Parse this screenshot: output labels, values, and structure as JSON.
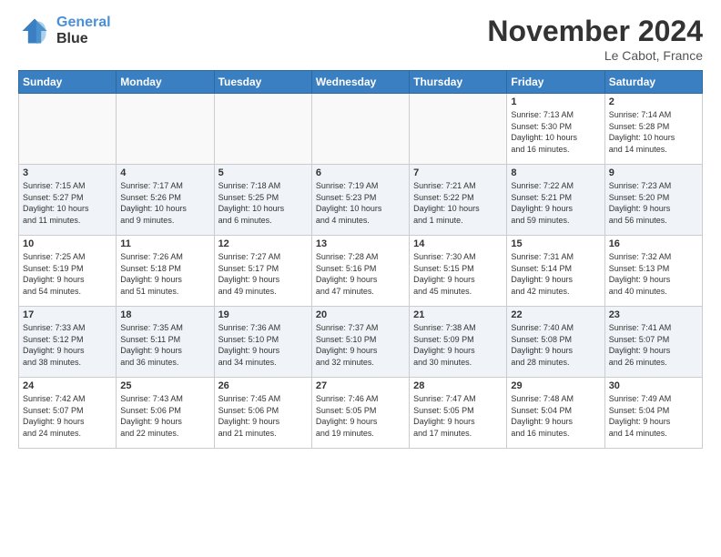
{
  "header": {
    "logo_line1": "General",
    "logo_line2": "Blue",
    "month_title": "November 2024",
    "location": "Le Cabot, France"
  },
  "weekdays": [
    "Sunday",
    "Monday",
    "Tuesday",
    "Wednesday",
    "Thursday",
    "Friday",
    "Saturday"
  ],
  "weeks": [
    [
      {
        "day": "",
        "info": ""
      },
      {
        "day": "",
        "info": ""
      },
      {
        "day": "",
        "info": ""
      },
      {
        "day": "",
        "info": ""
      },
      {
        "day": "",
        "info": ""
      },
      {
        "day": "1",
        "info": "Sunrise: 7:13 AM\nSunset: 5:30 PM\nDaylight: 10 hours\nand 16 minutes."
      },
      {
        "day": "2",
        "info": "Sunrise: 7:14 AM\nSunset: 5:28 PM\nDaylight: 10 hours\nand 14 minutes."
      }
    ],
    [
      {
        "day": "3",
        "info": "Sunrise: 7:15 AM\nSunset: 5:27 PM\nDaylight: 10 hours\nand 11 minutes."
      },
      {
        "day": "4",
        "info": "Sunrise: 7:17 AM\nSunset: 5:26 PM\nDaylight: 10 hours\nand 9 minutes."
      },
      {
        "day": "5",
        "info": "Sunrise: 7:18 AM\nSunset: 5:25 PM\nDaylight: 10 hours\nand 6 minutes."
      },
      {
        "day": "6",
        "info": "Sunrise: 7:19 AM\nSunset: 5:23 PM\nDaylight: 10 hours\nand 4 minutes."
      },
      {
        "day": "7",
        "info": "Sunrise: 7:21 AM\nSunset: 5:22 PM\nDaylight: 10 hours\nand 1 minute."
      },
      {
        "day": "8",
        "info": "Sunrise: 7:22 AM\nSunset: 5:21 PM\nDaylight: 9 hours\nand 59 minutes."
      },
      {
        "day": "9",
        "info": "Sunrise: 7:23 AM\nSunset: 5:20 PM\nDaylight: 9 hours\nand 56 minutes."
      }
    ],
    [
      {
        "day": "10",
        "info": "Sunrise: 7:25 AM\nSunset: 5:19 PM\nDaylight: 9 hours\nand 54 minutes."
      },
      {
        "day": "11",
        "info": "Sunrise: 7:26 AM\nSunset: 5:18 PM\nDaylight: 9 hours\nand 51 minutes."
      },
      {
        "day": "12",
        "info": "Sunrise: 7:27 AM\nSunset: 5:17 PM\nDaylight: 9 hours\nand 49 minutes."
      },
      {
        "day": "13",
        "info": "Sunrise: 7:28 AM\nSunset: 5:16 PM\nDaylight: 9 hours\nand 47 minutes."
      },
      {
        "day": "14",
        "info": "Sunrise: 7:30 AM\nSunset: 5:15 PM\nDaylight: 9 hours\nand 45 minutes."
      },
      {
        "day": "15",
        "info": "Sunrise: 7:31 AM\nSunset: 5:14 PM\nDaylight: 9 hours\nand 42 minutes."
      },
      {
        "day": "16",
        "info": "Sunrise: 7:32 AM\nSunset: 5:13 PM\nDaylight: 9 hours\nand 40 minutes."
      }
    ],
    [
      {
        "day": "17",
        "info": "Sunrise: 7:33 AM\nSunset: 5:12 PM\nDaylight: 9 hours\nand 38 minutes."
      },
      {
        "day": "18",
        "info": "Sunrise: 7:35 AM\nSunset: 5:11 PM\nDaylight: 9 hours\nand 36 minutes."
      },
      {
        "day": "19",
        "info": "Sunrise: 7:36 AM\nSunset: 5:10 PM\nDaylight: 9 hours\nand 34 minutes."
      },
      {
        "day": "20",
        "info": "Sunrise: 7:37 AM\nSunset: 5:10 PM\nDaylight: 9 hours\nand 32 minutes."
      },
      {
        "day": "21",
        "info": "Sunrise: 7:38 AM\nSunset: 5:09 PM\nDaylight: 9 hours\nand 30 minutes."
      },
      {
        "day": "22",
        "info": "Sunrise: 7:40 AM\nSunset: 5:08 PM\nDaylight: 9 hours\nand 28 minutes."
      },
      {
        "day": "23",
        "info": "Sunrise: 7:41 AM\nSunset: 5:07 PM\nDaylight: 9 hours\nand 26 minutes."
      }
    ],
    [
      {
        "day": "24",
        "info": "Sunrise: 7:42 AM\nSunset: 5:07 PM\nDaylight: 9 hours\nand 24 minutes."
      },
      {
        "day": "25",
        "info": "Sunrise: 7:43 AM\nSunset: 5:06 PM\nDaylight: 9 hours\nand 22 minutes."
      },
      {
        "day": "26",
        "info": "Sunrise: 7:45 AM\nSunset: 5:06 PM\nDaylight: 9 hours\nand 21 minutes."
      },
      {
        "day": "27",
        "info": "Sunrise: 7:46 AM\nSunset: 5:05 PM\nDaylight: 9 hours\nand 19 minutes."
      },
      {
        "day": "28",
        "info": "Sunrise: 7:47 AM\nSunset: 5:05 PM\nDaylight: 9 hours\nand 17 minutes."
      },
      {
        "day": "29",
        "info": "Sunrise: 7:48 AM\nSunset: 5:04 PM\nDaylight: 9 hours\nand 16 minutes."
      },
      {
        "day": "30",
        "info": "Sunrise: 7:49 AM\nSunset: 5:04 PM\nDaylight: 9 hours\nand 14 minutes."
      }
    ]
  ]
}
